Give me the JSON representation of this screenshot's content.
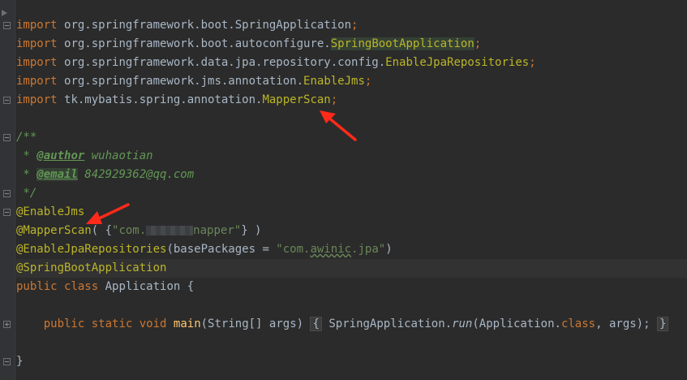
{
  "imports": [
    {
      "keyword": "import",
      "pkg": "org.springframework.boot.",
      "cls": "SpringApplication",
      "end": ";"
    },
    {
      "keyword": "import",
      "pkg": "org.springframework.boot.autoconfigure.",
      "cls": "SpringBootApplication",
      "end": ";"
    },
    {
      "keyword": "import",
      "pkg": "org.springframework.data.jpa.repository.config.",
      "cls": "EnableJpaRepositories",
      "end": ";"
    },
    {
      "keyword": "import",
      "pkg": "org.springframework.jms.annotation.",
      "cls": "EnableJms",
      "end": ";"
    },
    {
      "keyword": "import",
      "pkg": "tk.mybatis.spring.annotation.",
      "cls": "MapperScan",
      "end": ";"
    }
  ],
  "javadoc": {
    "open": "/**",
    "author_prefix": " * ",
    "author_tag": "@author",
    "author_value": " wuhaotian",
    "email_prefix": " * ",
    "email_tag": "@email",
    "email_value": " 842929362@qq.com",
    "close": " */"
  },
  "annotations": {
    "enable_jms": "@EnableJms",
    "mapper_scan": "@MapperScan",
    "mapper_scan_open": "( {",
    "mapper_scan_str_start": "\"com.",
    "mapper_scan_str_end": "napper\"",
    "mapper_scan_close": "} )",
    "enable_jpa": "@EnableJpaRepositories",
    "enable_jpa_args_open": "(basePackages = ",
    "enable_jpa_str_a": "\"com.",
    "enable_jpa_str_b": "awinic",
    "enable_jpa_str_c": ".jpa\"",
    "enable_jpa_args_close": ")",
    "spring_boot": "@SpringBootApplication"
  },
  "class_decl": {
    "kw_public": "public",
    "kw_class": "class",
    "name": "Application",
    "brace": " {"
  },
  "main_method": {
    "kw_public": "public",
    "kw_static": "static",
    "kw_void": "void",
    "name": "main",
    "params": "(String[] args) ",
    "body_open": "{",
    "call_cls": " SpringApplication.",
    "call_fn": "run",
    "call_args": "(Application.",
    "kw_class": "class",
    "call_end": ", args); ",
    "body_close": "}"
  },
  "closing_brace": "}",
  "colors": {
    "background": "#2b2b2b",
    "keyword": "#cc7832",
    "annotation": "#bbb529",
    "string": "#6a8759",
    "doc": "#629755",
    "default": "#a9b7c6",
    "arrow": "#ff2a1a"
  }
}
